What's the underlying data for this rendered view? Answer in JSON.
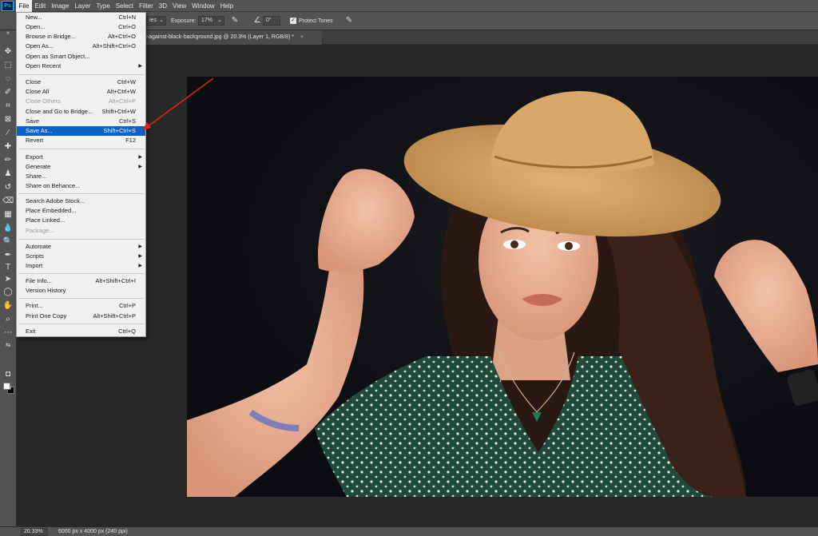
{
  "menubar": {
    "logo": "Ps",
    "items": [
      "File",
      "Edit",
      "Image",
      "Layer",
      "Type",
      "Select",
      "Filter",
      "3D",
      "View",
      "Window",
      "Help"
    ]
  },
  "options": {
    "range_value": "ies",
    "exposure_label": "Exposure:",
    "exposure_value": "17%",
    "angle_value": "0°",
    "protect_tones_label": "Protect Tones",
    "protect_tones_checked": true
  },
  "document": {
    "tab_title": "ng-against-black-background.jpg @ 20.3% (Layer 1, RGB/8) *",
    "tab_close": "×"
  },
  "file_menu": {
    "items": [
      {
        "label": "New...",
        "shortcut": "Ctrl+N"
      },
      {
        "label": "Open...",
        "shortcut": "Ctrl+O"
      },
      {
        "label": "Browse in Bridge...",
        "shortcut": "Alt+Ctrl+O"
      },
      {
        "label": "Open As...",
        "shortcut": "Alt+Shift+Ctrl+O"
      },
      {
        "label": "Open as Smart Object...",
        "shortcut": ""
      },
      {
        "label": "Open Recent",
        "shortcut": "",
        "submenu": true
      },
      {
        "label": "Close",
        "shortcut": "Ctrl+W"
      },
      {
        "label": "Close All",
        "shortcut": "Alt+Ctrl+W"
      },
      {
        "label": "Close Others",
        "shortcut": "Alt+Ctrl+P",
        "disabled": true
      },
      {
        "label": "Close and Go to Bridge...",
        "shortcut": "Shift+Ctrl+W"
      },
      {
        "label": "Save",
        "shortcut": "Ctrl+S"
      },
      {
        "label": "Save As...",
        "shortcut": "Shift+Ctrl+S",
        "highlighted": true
      },
      {
        "label": "Revert",
        "shortcut": "F12"
      },
      {
        "label": "Export",
        "shortcut": "",
        "submenu": true
      },
      {
        "label": "Generate",
        "shortcut": "",
        "submenu": true
      },
      {
        "label": "Share...",
        "shortcut": ""
      },
      {
        "label": "Share on Behance...",
        "shortcut": ""
      },
      {
        "label": "Search Adobe Stock...",
        "shortcut": ""
      },
      {
        "label": "Place Embedded...",
        "shortcut": ""
      },
      {
        "label": "Place Linked...",
        "shortcut": ""
      },
      {
        "label": "Package...",
        "shortcut": "",
        "disabled": true
      },
      {
        "label": "Automate",
        "shortcut": "",
        "submenu": true
      },
      {
        "label": "Scripts",
        "shortcut": "",
        "submenu": true
      },
      {
        "label": "Import",
        "shortcut": "",
        "submenu": true
      },
      {
        "label": "File Info...",
        "shortcut": "Alt+Shift+Ctrl+I"
      },
      {
        "label": "Version History",
        "shortcut": ""
      },
      {
        "label": "Print...",
        "shortcut": "Ctrl+P"
      },
      {
        "label": "Print One Copy",
        "shortcut": "Alt+Shift+Ctrl+P"
      },
      {
        "label": "Exit",
        "shortcut": "Ctrl+Q"
      }
    ]
  },
  "status": {
    "zoom": "20.33%",
    "doc_info": "6000 px x 4000 px (240 ppi)"
  },
  "tools": [
    "move-icon",
    "marquee-icon",
    "lasso-icon",
    "quick-select-icon",
    "crop-icon",
    "frame-icon",
    "eyedropper-icon",
    "healing-icon",
    "brush-icon",
    "clone-stamp-icon",
    "history-brush-icon",
    "eraser-icon",
    "gradient-icon",
    "blur-icon",
    "dodge-icon",
    "pen-icon",
    "type-icon",
    "path-select-icon",
    "shape-icon",
    "hand-icon",
    "zoom-icon"
  ],
  "colors": {
    "foreground": "#ffffff",
    "background": "#000000",
    "highlight": "#0a62c6",
    "annotation": "#d9261c"
  }
}
